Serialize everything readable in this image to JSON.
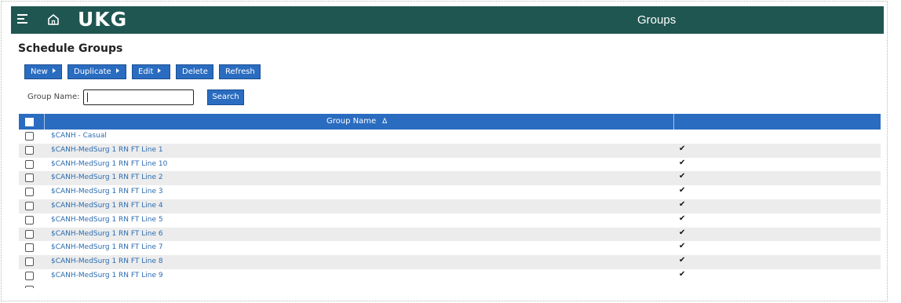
{
  "app": {
    "logo": "UKG",
    "window_title": "Groups"
  },
  "page": {
    "title": "Schedule Groups"
  },
  "toolbar": {
    "new_label": "New",
    "duplicate_label": "Duplicate",
    "edit_label": "Edit",
    "delete_label": "Delete",
    "refresh_label": "Refresh"
  },
  "search": {
    "label": "Group Name:",
    "value": "",
    "button_label": "Search"
  },
  "table": {
    "column_header": "Group Name",
    "sort_indicator": "Δ",
    "rows": [
      {
        "name": "$CANH - Casual",
        "checked": false
      },
      {
        "name": "$CANH-MedSurg 1 RN FT Line 1",
        "checked": true
      },
      {
        "name": "$CANH-MedSurg 1 RN FT Line 10",
        "checked": true
      },
      {
        "name": "$CANH-MedSurg 1 RN FT Line 2",
        "checked": true
      },
      {
        "name": "$CANH-MedSurg 1 RN FT Line 3",
        "checked": true
      },
      {
        "name": "$CANH-MedSurg 1 RN FT Line 4",
        "checked": true
      },
      {
        "name": "$CANH-MedSurg 1 RN FT Line 5",
        "checked": true
      },
      {
        "name": "$CANH-MedSurg 1 RN FT Line 6",
        "checked": true
      },
      {
        "name": "$CANH-MedSurg 1 RN FT Line 7",
        "checked": true
      },
      {
        "name": "$CANH-MedSurg 1 RN FT Line 8",
        "checked": true
      },
      {
        "name": "$CANH-MedSurg 1 RN FT Line 9",
        "checked": true
      }
    ],
    "check_glyph": "✔"
  },
  "colors": {
    "topbar": "#1f5651",
    "accent": "#2a6cc0",
    "link": "#2b6cb0"
  }
}
